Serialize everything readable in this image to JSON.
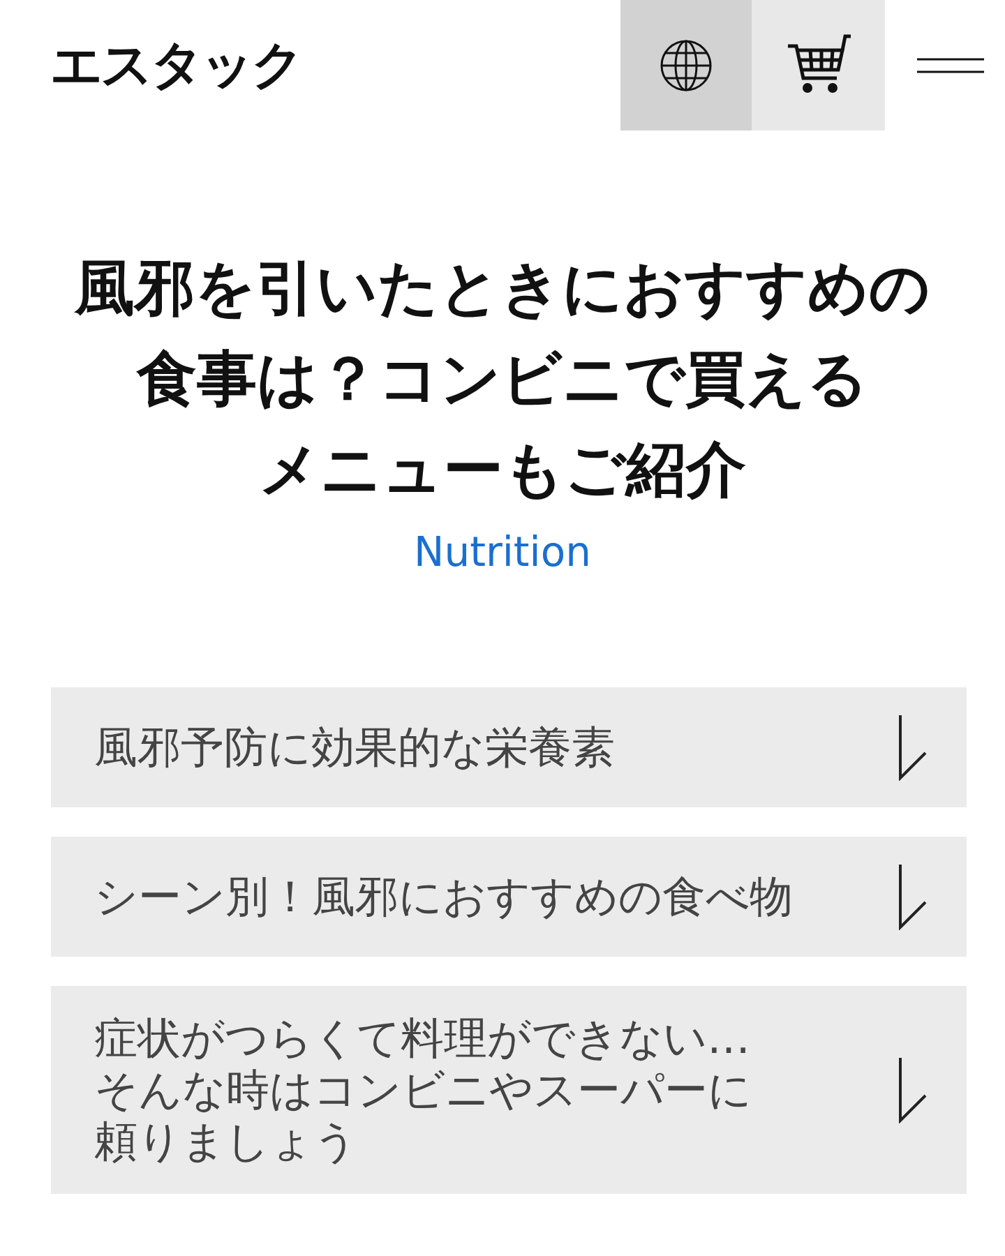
{
  "header": {
    "logo": "エスタック"
  },
  "article": {
    "title_lines": [
      "風邪を引いたときにおすすめの",
      "食事は？コンビニで買える",
      "メニューもご紹介"
    ],
    "category": "Nutrition"
  },
  "sections": [
    {
      "lines": [
        "風邪予防に効果的な栄養素"
      ]
    },
    {
      "lines": [
        "シーン別！風邪におすすめの食べ物"
      ]
    },
    {
      "lines": [
        "症状がつらくて料理ができない…",
        "そんな時はコンビニやスーパーに",
        "頼りましょう"
      ]
    }
  ]
}
